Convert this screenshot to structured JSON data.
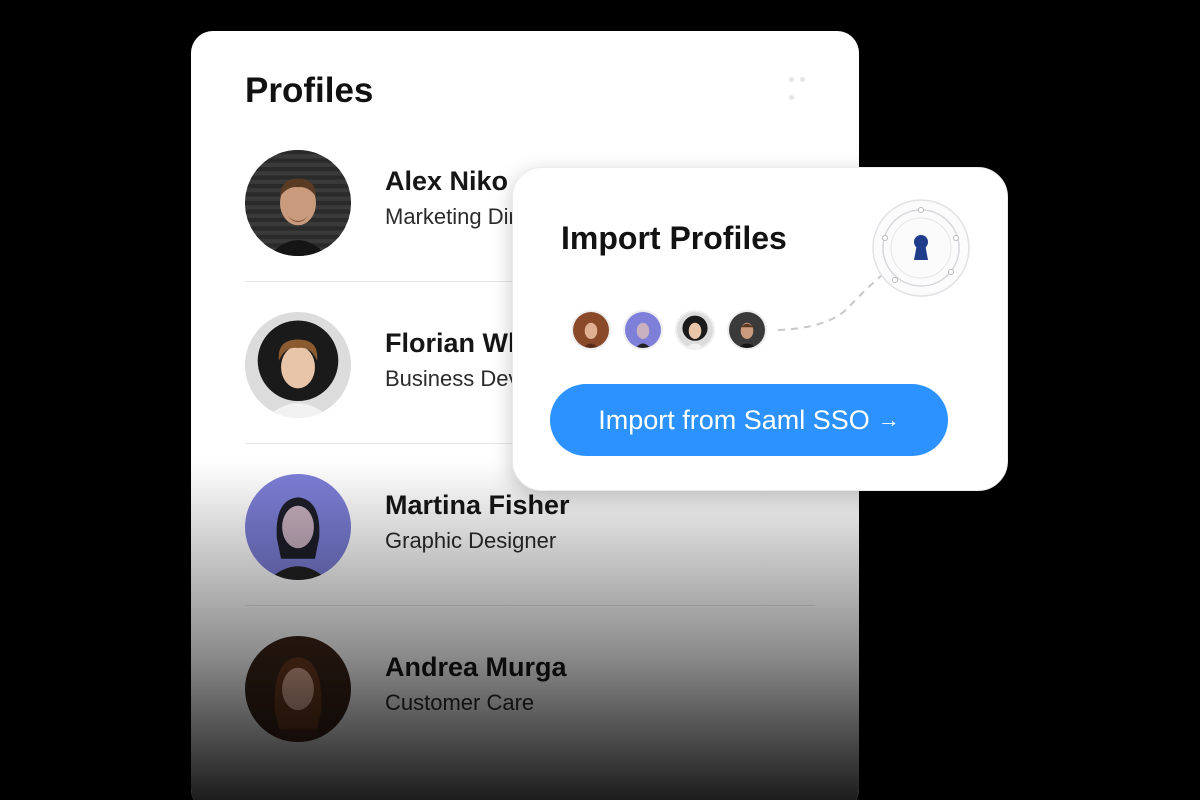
{
  "profiles": {
    "title": "Profiles",
    "items": [
      {
        "name": "Alex Niko",
        "role": "Marketing Director",
        "skin": "#c99a7c",
        "hair": "#5a3a22",
        "bg": "#3a3a3a",
        "shirt": "#151515"
      },
      {
        "name": "Florian White",
        "role": "Business Developer",
        "skin": "#e8c4a8",
        "hair": "#8a5a30",
        "bg": "#dcdcdc",
        "shirt": "#f2f2f2"
      },
      {
        "name": "Martina Fisher",
        "role": "Graphic Designer",
        "skin": "#c8b0c0",
        "hair": "#1e1e2a",
        "bg": "#7d7fd8",
        "shirt": "#222"
      },
      {
        "name": "Andrea Murga",
        "role": "Customer Care",
        "skin": "#d8a890",
        "hair": "#6a3a1e",
        "bg": "#3a2418",
        "shirt": "#4a2a20"
      }
    ]
  },
  "import": {
    "title": "Import Profiles",
    "button_label": "Import from Saml SSO",
    "button_arrow": "→",
    "accent": "#2b92ff",
    "lock_color": "#1f3d8a"
  }
}
